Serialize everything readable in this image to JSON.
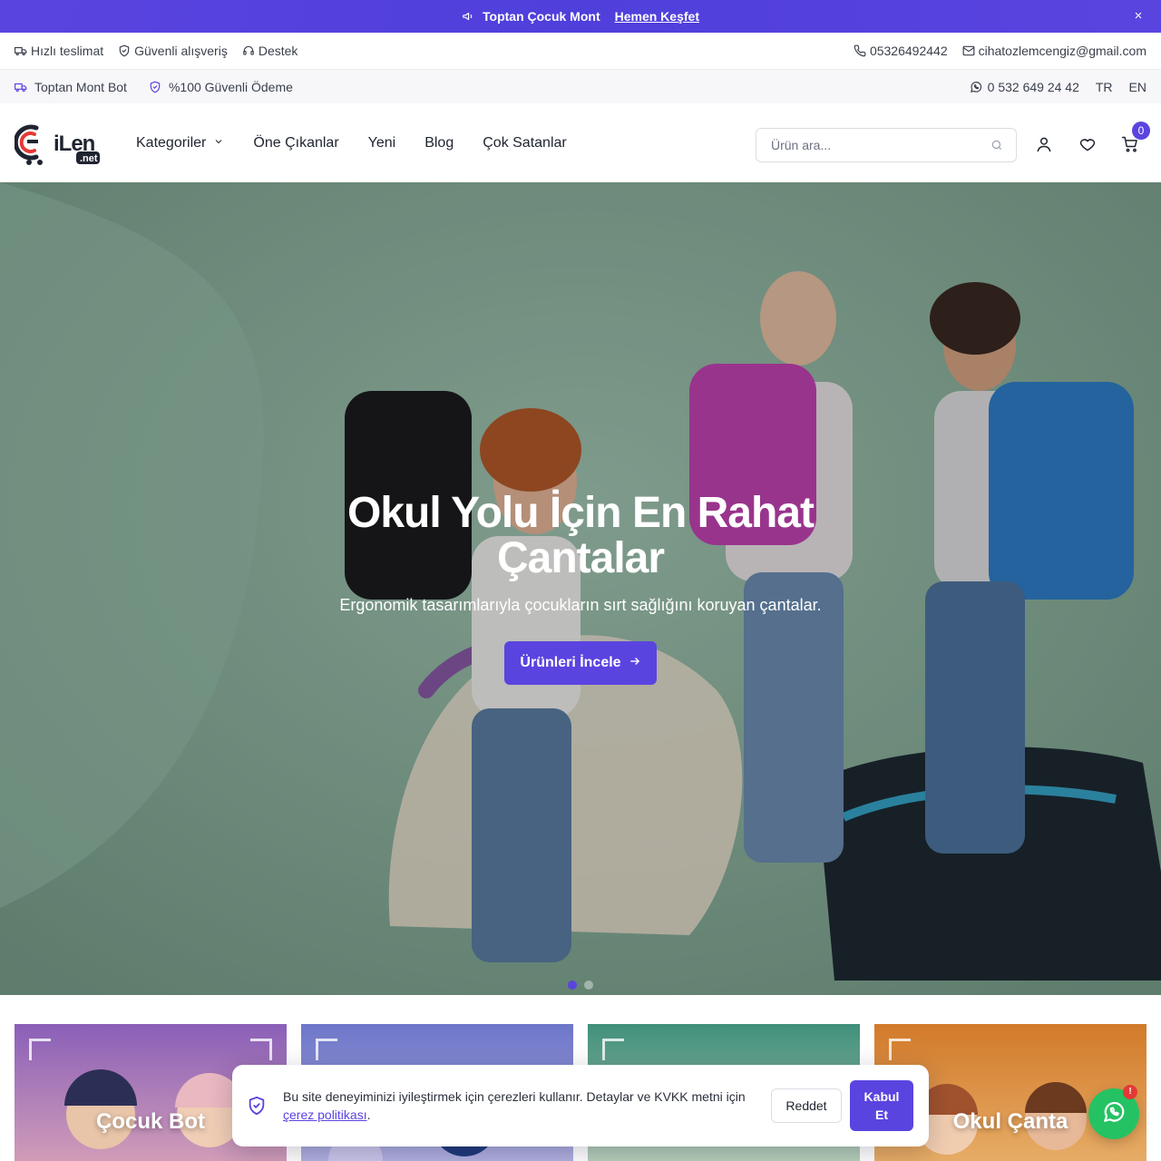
{
  "announcement": {
    "text": "Toptan Çocuk Mont",
    "link": "Hemen Keşfet",
    "icon": "megaphone-icon",
    "close_label": "×"
  },
  "infobar": {
    "left": [
      {
        "icon": "truck-icon",
        "label": "Hızlı teslimat"
      },
      {
        "icon": "shield-icon",
        "label": "Güvenli alışveriş"
      },
      {
        "icon": "headset-icon",
        "label": "Destek"
      }
    ],
    "phone": "05326492442",
    "email": "cihatozlemcengiz@gmail.com"
  },
  "subbar": {
    "left": [
      {
        "icon": "truck-icon",
        "label": "Toptan Mont Bot"
      },
      {
        "icon": "shield-check-icon",
        "label": "%100 Güvenli Ödeme"
      }
    ],
    "whatsapp": "0 532 649 24 42",
    "languages": [
      "TR",
      "EN"
    ]
  },
  "header": {
    "logo_text": "iLen",
    "logo_sub": ".net",
    "nav": [
      {
        "label": "Kategoriler",
        "dropdown": true
      },
      {
        "label": "Öne Çıkanlar"
      },
      {
        "label": "Yeni"
      },
      {
        "label": "Blog"
      },
      {
        "label": "Çok Satanlar"
      }
    ],
    "search_placeholder": "Ürün ara...",
    "cart_count": "0"
  },
  "hero": {
    "title": "Okul Yolu İçin En Rahat Çantalar",
    "subtitle": "Ergonomik tasarımlarıyla çocukların sırt sağlığını koruyan çantalar.",
    "cta": "Ürünleri İncele",
    "slides": 2,
    "active_slide": 1
  },
  "categories": [
    {
      "label": "Çocuk Bot",
      "color_top": "#8a5fb8",
      "color_bottom": "#d9a4b8"
    },
    {
      "label": "",
      "color_top": "#6d76c9",
      "color_bottom": "#b9b7e3"
    },
    {
      "label": "",
      "color_top": "#3f8f7a",
      "color_bottom": "#c8d7c4"
    },
    {
      "label": "Okul Çanta",
      "color_top": "#d27a2a",
      "color_bottom": "#e9b36e"
    }
  ],
  "cookie": {
    "text": "Bu site deneyiminizi iyileştirmek için çerezleri kullanır. Detaylar ve KVKK metni için",
    "link": "çerez politikası",
    "reject": "Reddet",
    "accept": "Kabul Et"
  },
  "whatsapp_badge": "!",
  "colors": {
    "accent": "#5a44e0",
    "whatsapp": "#25c263"
  }
}
